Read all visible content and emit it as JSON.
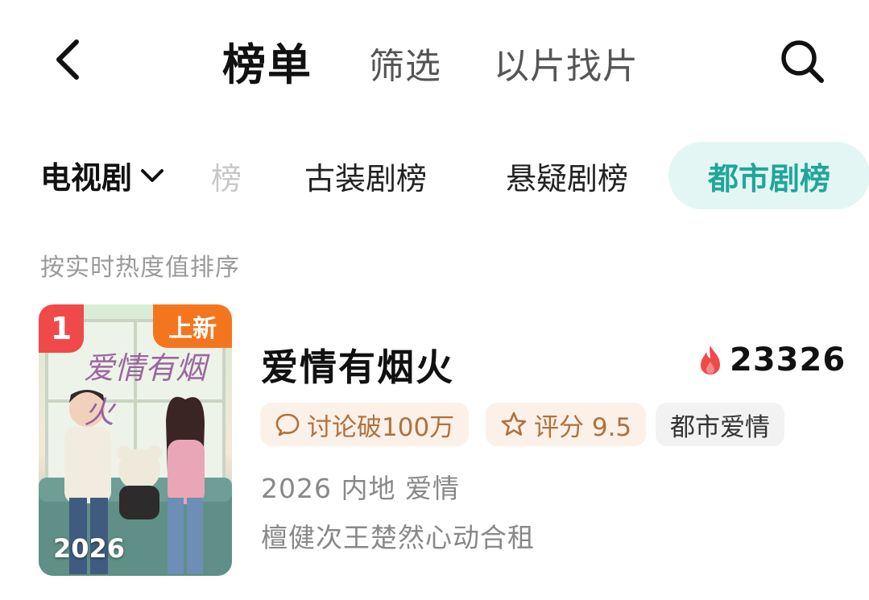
{
  "nav": {
    "title": "榜单",
    "tabs": [
      "筛选",
      "以片找片"
    ]
  },
  "categories": {
    "selector_label": "电视剧",
    "faded_chip": "榜",
    "chips": [
      "古装剧榜",
      "悬疑剧榜",
      "都市剧榜"
    ],
    "active_index": 2
  },
  "sort_hint": "按实时热度值排序",
  "item": {
    "rank": "1",
    "new_badge": "上新",
    "poster_year": "2026",
    "poster_art_text": "爱情有烟火",
    "title": "爱情有烟火",
    "heat": "23326",
    "tags": {
      "discuss": "讨论破100万",
      "score": "评分 9.5",
      "genre": "都市爱情"
    },
    "meta": "2026 内地 爱情",
    "cast": "檀健次王楚然心动合租"
  },
  "colors": {
    "accent": "#1fa69a",
    "accent_bg": "#e4f6f4",
    "rank_red": "#f0494a",
    "new_orange": "#f3761f",
    "tag_brown": "#b0713e",
    "tag_bg": "#fbf1e8",
    "fire": "#f0494a"
  }
}
